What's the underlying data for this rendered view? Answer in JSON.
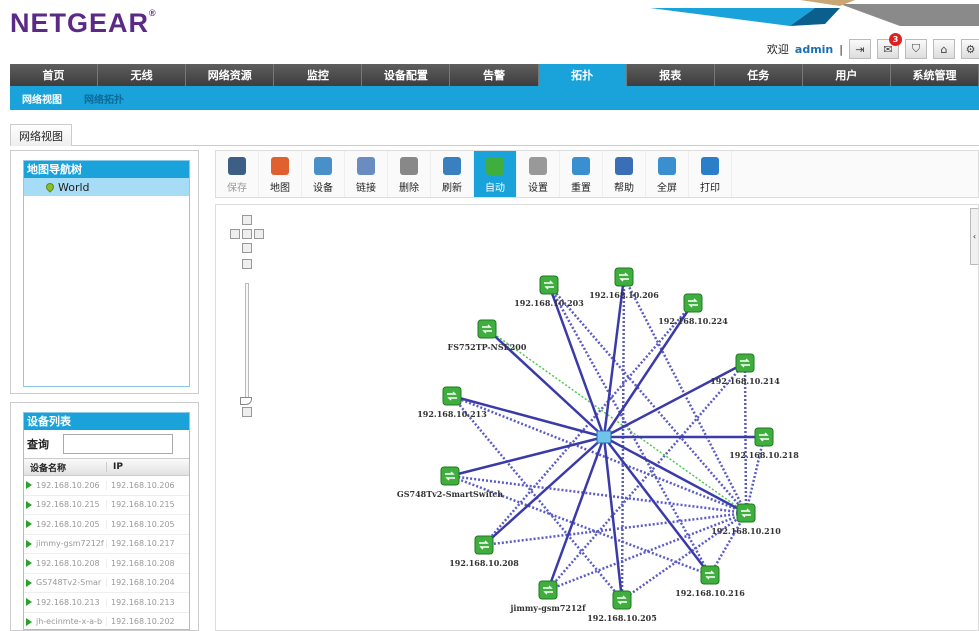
{
  "brand": {
    "logo": "NETGEAR",
    "mark": "®"
  },
  "header": {
    "welcome": "欢迎",
    "user": "admin",
    "separator": "|",
    "mail_badge": "3"
  },
  "colors": {
    "accent": "#1aa3da",
    "nav_bg": "#4a4a4a",
    "link_solid": "#3a3aa8",
    "link_dashed": "#5b5bc7",
    "link_green": "#4ec94e",
    "node": "#3fae3f",
    "brand": "#5b2a86"
  },
  "nav": {
    "tabs": [
      "首页",
      "无线",
      "网络资源",
      "监控",
      "设备配置",
      "告警",
      "拓扑",
      "报表",
      "任务",
      "用户",
      "系统管理"
    ],
    "active": "拓扑"
  },
  "subnav": {
    "items": [
      "网络视图",
      "网络拓扑"
    ]
  },
  "page_tab": "网络视图",
  "nav_tree": {
    "title": "地图导航树",
    "items": [
      "World"
    ]
  },
  "device_list": {
    "title": "设备列表",
    "search_label": "查询",
    "search_value": "",
    "columns": [
      "设备名称",
      "IP"
    ],
    "rows": [
      [
        "192.168.10.206",
        "192.168.10.206"
      ],
      [
        "192.168.10.215",
        "192.168.10.215"
      ],
      [
        "192.168.10.205",
        "192.168.10.205"
      ],
      [
        "jimmy-gsm7212f",
        "192.168.10.217"
      ],
      [
        "192.168.10.208",
        "192.168.10.208"
      ],
      [
        "GS748Tv2-Smar",
        "192.168.10.204"
      ],
      [
        "192.168.10.213",
        "192.168.10.213"
      ],
      [
        "jh-ecinmte-x-a-b",
        "192.168.10.202"
      ]
    ]
  },
  "toolbar": {
    "buttons": [
      {
        "label": "保存",
        "icon": "save-icon",
        "color": "#3d5f86",
        "disabled": true
      },
      {
        "label": "地图",
        "icon": "map-icon",
        "color": "#e06030"
      },
      {
        "label": "设备",
        "icon": "device-icon",
        "color": "#4a90c8"
      },
      {
        "label": "链接",
        "icon": "link-icon",
        "color": "#6a8cc0"
      },
      {
        "label": "删除",
        "icon": "trash-icon",
        "color": "#888888"
      },
      {
        "label": "刷新",
        "icon": "refresh-icon",
        "color": "#3a7fc0"
      },
      {
        "label": "自动",
        "icon": "auto-layout-icon",
        "color": "#3fae3f",
        "active": true
      },
      {
        "label": "设置",
        "icon": "gear-icon",
        "color": "#999999"
      },
      {
        "label": "重置",
        "icon": "undo-icon",
        "color": "#3a8fd0"
      },
      {
        "label": "帮助",
        "icon": "help-icon",
        "color": "#3a6fb8"
      },
      {
        "label": "全屏",
        "icon": "fullscreen-icon",
        "color": "#3a8fd0"
      },
      {
        "label": "打印",
        "icon": "print-icon",
        "color": "#2a7fc8"
      }
    ]
  },
  "topology": {
    "hub": {
      "id": "hub",
      "label": ""
    },
    "nodes": [
      {
        "id": "n206",
        "label": "192.168.10.206"
      },
      {
        "id": "n203",
        "label": "192.168.10.203"
      },
      {
        "id": "n224",
        "label": "192.168.10.224"
      },
      {
        "id": "n200",
        "label": "FS752TP-NSE200"
      },
      {
        "id": "n214",
        "label": "192.168.10.214"
      },
      {
        "id": "n213",
        "label": "192.168.10.213"
      },
      {
        "id": "n218",
        "label": "192.168.10.218"
      },
      {
        "id": "nGS",
        "label": "GS748Tv2-SmartSwitch"
      },
      {
        "id": "n210",
        "label": "192.168.10.210"
      },
      {
        "id": "n208",
        "label": "192.168.10.208"
      },
      {
        "id": "n216",
        "label": "192.168.10.216"
      },
      {
        "id": "njimmy",
        "label": "jimmy-gsm7212f"
      },
      {
        "id": "n205",
        "label": "192.168.10.205"
      }
    ],
    "solid_links": [
      [
        "hub",
        "n206"
      ],
      [
        "hub",
        "n203"
      ],
      [
        "hub",
        "n224"
      ],
      [
        "hub",
        "n214"
      ],
      [
        "hub",
        "n213"
      ],
      [
        "hub",
        "n218"
      ],
      [
        "hub",
        "nGS"
      ],
      [
        "hub",
        "n208"
      ],
      [
        "hub",
        "n216"
      ],
      [
        "hub",
        "njimmy"
      ],
      [
        "hub",
        "n205"
      ],
      [
        "hub",
        "n210"
      ],
      [
        "n200",
        "hub"
      ]
    ],
    "dashed_links": [
      [
        "n210",
        "n206"
      ],
      [
        "n210",
        "n203"
      ],
      [
        "n210",
        "n213"
      ],
      [
        "n210",
        "nGS"
      ],
      [
        "n210",
        "n208"
      ],
      [
        "n210",
        "njimmy"
      ],
      [
        "n210",
        "n205"
      ],
      [
        "n210",
        "n216"
      ],
      [
        "n210",
        "n214"
      ],
      [
        "n210",
        "n218"
      ],
      [
        "n203",
        "n216"
      ],
      [
        "n206",
        "n205"
      ],
      [
        "nGS",
        "n216"
      ],
      [
        "n213",
        "n205"
      ],
      [
        "n208",
        "n224"
      ],
      [
        "njimmy",
        "n214"
      ]
    ],
    "green_links": [
      [
        "n200",
        "n210"
      ]
    ]
  }
}
